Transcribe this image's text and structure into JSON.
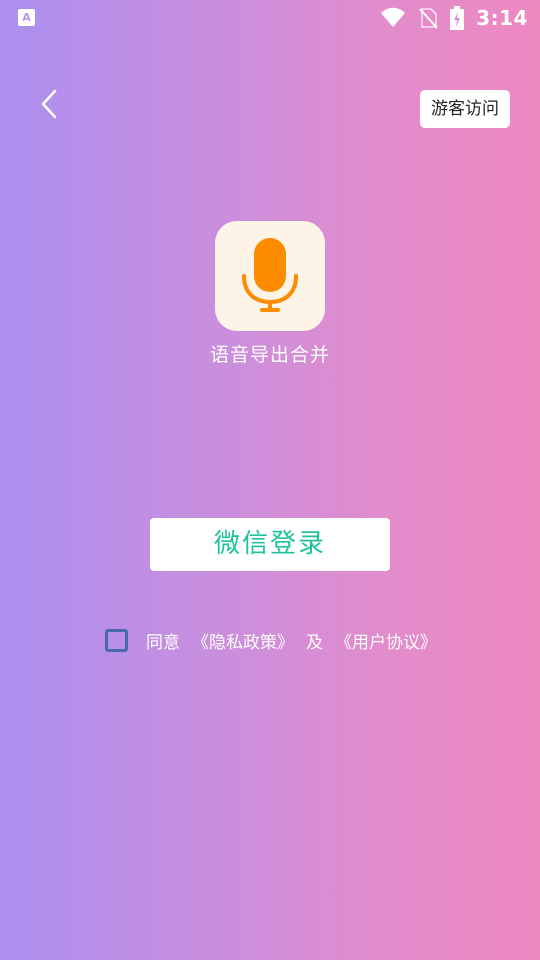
{
  "status_bar": {
    "left_icon_letter": "A",
    "time": "3:14",
    "icons": [
      "wifi-icon",
      "no-sim-icon",
      "battery-charging-icon"
    ]
  },
  "header": {
    "back_icon": "chevron-left-icon",
    "guest_label": "游客访问"
  },
  "app": {
    "logo_icon": "microphone-icon",
    "name": "语音导出合并",
    "logo_bg": "#fdf3e6",
    "logo_color": "#fb8c00"
  },
  "login": {
    "wechat_label": "微信登录",
    "accent": "#1fc29a"
  },
  "agreement": {
    "agree": "同意",
    "privacy_link": "《隐私政策》",
    "and": "及",
    "user_link": "《用户协议》",
    "checked": false
  },
  "colors": {
    "gradient_start": "#ab8ff0",
    "gradient_end": "#ee88c0",
    "checkbox_border": "#4a6cae"
  }
}
